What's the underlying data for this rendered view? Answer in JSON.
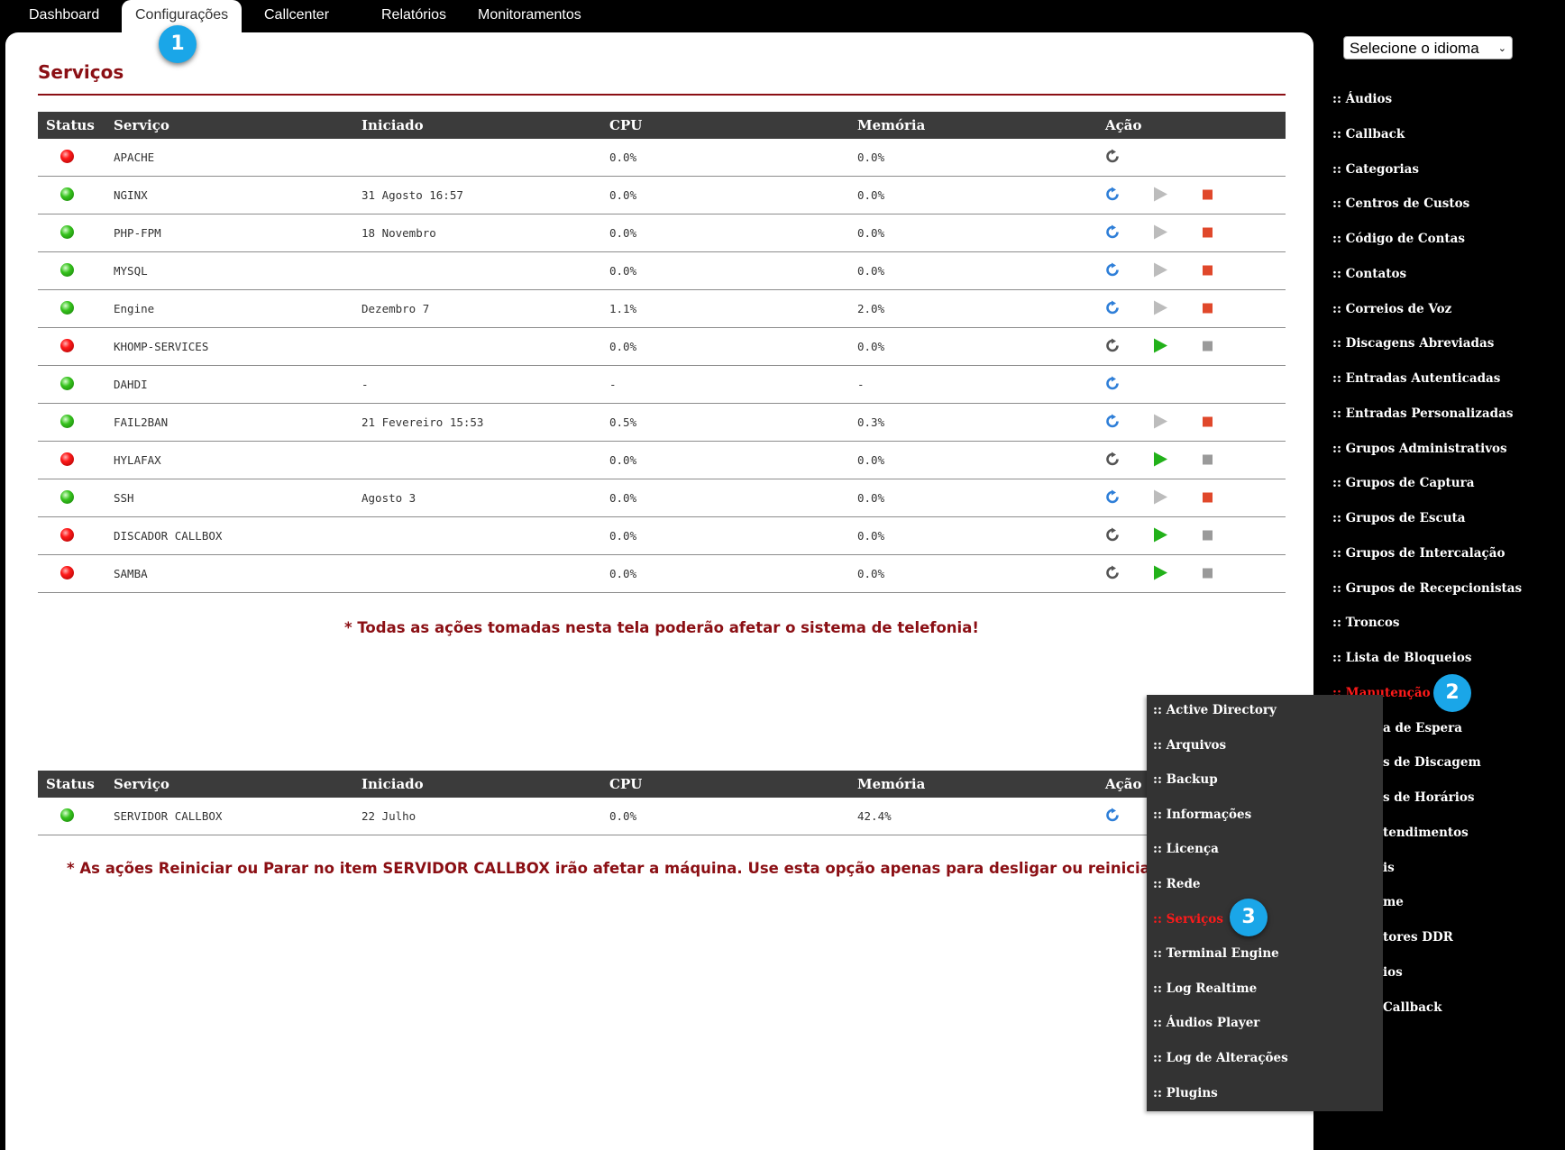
{
  "top_nav": [
    {
      "label": "Dashboard"
    },
    {
      "label": "Configurações",
      "active": true
    },
    {
      "label": "Callcenter"
    },
    {
      "label": "Relatórios"
    },
    {
      "label": "Monitoramentos"
    }
  ],
  "callouts": [
    "1",
    "2",
    "3"
  ],
  "page_title": "Serviços",
  "table_headers": [
    "Status",
    "Serviço",
    "Iniciado",
    "CPU",
    "Memória",
    "Ação"
  ],
  "services": [
    {
      "status": "red",
      "name": "APACHE",
      "started": "",
      "cpu": "0.0%",
      "mem": "0.0%",
      "actions": [
        "restart-gray"
      ]
    },
    {
      "status": "green",
      "name": "NGINX",
      "started": "31 Agosto 16:57",
      "cpu": "0.0%",
      "mem": "0.0%",
      "actions": [
        "restart-blue",
        "play-gray",
        "stop-red"
      ]
    },
    {
      "status": "green",
      "name": "PHP-FPM",
      "started": "18 Novembro",
      "cpu": "0.0%",
      "mem": "0.0%",
      "actions": [
        "restart-blue",
        "play-gray",
        "stop-red"
      ]
    },
    {
      "status": "green",
      "name": "MYSQL",
      "started": "",
      "cpu": "0.0%",
      "mem": "0.0%",
      "actions": [
        "restart-blue",
        "play-gray",
        "stop-red"
      ]
    },
    {
      "status": "green",
      "name": "Engine",
      "started": "Dezembro 7",
      "cpu": "1.1%",
      "mem": "2.0%",
      "actions": [
        "restart-blue",
        "play-gray",
        "stop-red"
      ]
    },
    {
      "status": "red",
      "name": "KHOMP-SERVICES",
      "started": "",
      "cpu": "0.0%",
      "mem": "0.0%",
      "actions": [
        "restart-gray",
        "play-green",
        "stop-gray"
      ]
    },
    {
      "status": "green",
      "name": "DAHDI",
      "started": "-",
      "cpu": "-",
      "mem": "-",
      "actions": [
        "restart-blue"
      ]
    },
    {
      "status": "green",
      "name": "FAIL2BAN",
      "started": "21 Fevereiro 15:53",
      "cpu": "0.5%",
      "mem": "0.3%",
      "actions": [
        "restart-blue",
        "play-gray",
        "stop-red"
      ]
    },
    {
      "status": "red",
      "name": "HYLAFAX",
      "started": "",
      "cpu": "0.0%",
      "mem": "0.0%",
      "actions": [
        "restart-gray",
        "play-green",
        "stop-gray"
      ]
    },
    {
      "status": "green",
      "name": "SSH",
      "started": "Agosto 3",
      "cpu": "0.0%",
      "mem": "0.0%",
      "actions": [
        "restart-blue",
        "play-gray",
        "stop-red"
      ]
    },
    {
      "status": "red",
      "name": "DISCADOR CALLBOX",
      "started": "",
      "cpu": "0.0%",
      "mem": "0.0%",
      "actions": [
        "restart-gray",
        "play-green",
        "stop-gray"
      ]
    },
    {
      "status": "red",
      "name": "SAMBA",
      "started": "",
      "cpu": "0.0%",
      "mem": "0.0%",
      "actions": [
        "restart-gray",
        "play-green",
        "stop-gray"
      ]
    }
  ],
  "warning_1": "* Todas as ações tomadas nesta tela poderão afetar o sistema de telefonia!",
  "server_services": [
    {
      "status": "green",
      "name": "SERVIDOR CALLBOX",
      "started": "22 Julho",
      "cpu": "0.0%",
      "mem": "42.4%",
      "actions": [
        "restart-blue"
      ]
    }
  ],
  "warning_2": "* As ações Reiniciar ou Parar no item SERVIDOR CALLBOX irão afetar a máquina. Use esta opção apenas para desligar ou reinicia",
  "language_select": {
    "value": "Selecione o idioma"
  },
  "sidebar_items": [
    {
      "label": ":: Áudios"
    },
    {
      "label": ":: Callback"
    },
    {
      "label": ":: Categorias"
    },
    {
      "label": ":: Centros de Custos"
    },
    {
      "label": ":: Código de Contas"
    },
    {
      "label": ":: Contatos"
    },
    {
      "label": ":: Correios de Voz"
    },
    {
      "label": ":: Discagens Abreviadas"
    },
    {
      "label": ":: Entradas Autenticadas"
    },
    {
      "label": ":: Entradas Personalizadas"
    },
    {
      "label": ":: Grupos Administrativos"
    },
    {
      "label": ":: Grupos de Captura"
    },
    {
      "label": ":: Grupos de Escuta"
    },
    {
      "label": ":: Grupos de Intercalação"
    },
    {
      "label": ":: Grupos de Recepcionistas"
    },
    {
      "label": ":: Troncos"
    },
    {
      "label": ":: Lista de Bloqueios"
    },
    {
      "label": ":: Manutenção",
      "active": true
    },
    {
      "label": "a de Espera"
    },
    {
      "label": "s de Discagem"
    },
    {
      "label": "s de Horários"
    },
    {
      "label": "tendimentos"
    },
    {
      "label": "is"
    },
    {
      "label": "me"
    },
    {
      "label": "tores DDR"
    },
    {
      "label": "ios"
    },
    {
      "label": "Callback"
    }
  ],
  "submenu_items": [
    {
      "label": ":: Active Directory"
    },
    {
      "label": ":: Arquivos"
    },
    {
      "label": ":: Backup"
    },
    {
      "label": ":: Informações"
    },
    {
      "label": ":: Licença"
    },
    {
      "label": ":: Rede"
    },
    {
      "label": ":: Serviços",
      "active": true
    },
    {
      "label": ":: Terminal Engine"
    },
    {
      "label": ":: Log Realtime"
    },
    {
      "label": ":: Áudios Player"
    },
    {
      "label": ":: Log de Alterações"
    },
    {
      "label": ":: Plugins"
    }
  ],
  "colors": {
    "brand_red": "#8b0f14",
    "header_bg": "#3b3b3b",
    "callout_blue": "#1aa6e8",
    "active_link": "#ff1a1a"
  }
}
